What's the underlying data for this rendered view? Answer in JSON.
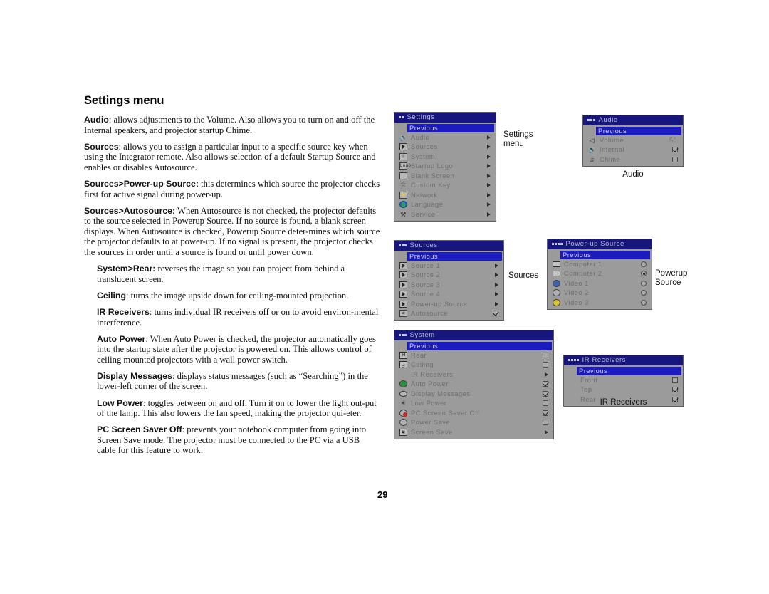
{
  "document": {
    "title": "Settings menu",
    "page_number": "29",
    "paragraphs": [
      {
        "id": "audio",
        "term": "Audio",
        "text": ": allows adjustments to the Volume. Also allows you to turn on and off the Internal speakers, and projector startup Chime.",
        "indent": false
      },
      {
        "id": "sources",
        "term": "Sources",
        "text": ": allows you to assign a particular input to a specific source key when using the Integrator remote. Also allows selection of a default Startup Source and enables or disables Autosource.",
        "indent": false
      },
      {
        "id": "sources-power-up-source",
        "term": "Sources>Power-up Source:",
        "text": " this determines which source the projector checks first for active signal during power-up.",
        "indent": false
      },
      {
        "id": "sources-autosource",
        "term": "Sources>Autosource:",
        "text": " When Autosource is not checked, the projector defaults to the source selected in Powerup Source. If no source is found, a blank screen displays. When Autosource is checked, Powerup Source deter-mines which source the projector defaults to at power-up. If no signal is present, the projector checks the sources in order until a source is found or until power down.",
        "indent": false
      },
      {
        "id": "system-rear",
        "term": "System>Rear:",
        "text": " reverses the image so you can project from behind a translucent screen.",
        "indent": true
      },
      {
        "id": "ceiling",
        "term": "Ceiling",
        "text": ": turns the image upside down for ceiling-mounted projection.",
        "indent": true
      },
      {
        "id": "ir-receivers",
        "term": "IR Receivers",
        "text": ": turns individual IR receivers off or on to avoid environ-mental interference.",
        "indent": true
      },
      {
        "id": "auto-power",
        "term": "Auto Power",
        "text": ": When Auto Power is checked, the projector automatically goes into the startup state after the projector is powered on. This allows control of ceiling mounted projectors with a wall power switch.",
        "indent": true
      },
      {
        "id": "display-messages",
        "term": "Display Messages",
        "text": ": displays status messages (such as “Searching”) in the lower-left corner of the screen.",
        "indent": true
      },
      {
        "id": "low-power",
        "term": "Low Power",
        "text": ": toggles between on and off. Turn it on to lower the light out-put of the lamp. This also lowers the fan speed, making the projector qui-eter.",
        "indent": true
      },
      {
        "id": "pc-screen-saver-off",
        "term": "PC Screen Saver Off",
        "text": ": prevents your notebook computer from going into Screen Save mode. The projector must be connected to the PC via a USB cable for this feature to work.",
        "indent": true
      }
    ]
  },
  "captions": {
    "settings_menu": "Settings\nmenu",
    "settings_menu_l1": "Settings",
    "settings_menu_l2": "menu",
    "audio": "Audio",
    "sources": "Sources",
    "powerup_source_l1": "Powerup",
    "powerup_source_l2": "Source",
    "ir_receivers": "IR Receivers"
  },
  "menus": {
    "settings": {
      "title": "Settings",
      "dots": 2,
      "previous": "Previous",
      "items": [
        {
          "label": "Audio",
          "icon": "speaker-icon",
          "control": "arrow"
        },
        {
          "label": "Sources",
          "icon": "source-input-icon",
          "control": "arrow"
        },
        {
          "label": "System",
          "icon": "system-icon",
          "control": "arrow"
        },
        {
          "label": "Startup Logo",
          "icon": "logo-icon",
          "control": "arrow"
        },
        {
          "label": "Blank Screen",
          "icon": "blank-screen-icon",
          "control": "arrow"
        },
        {
          "label": "Custom Key",
          "icon": "star-icon",
          "control": "arrow"
        },
        {
          "label": "Network",
          "icon": "network-icon",
          "control": "arrow"
        },
        {
          "label": "Language",
          "icon": "globe-icon",
          "control": "arrow"
        },
        {
          "label": "Service",
          "icon": "wrench-icon",
          "control": "arrow"
        }
      ]
    },
    "audio": {
      "title": "Audio",
      "dots": 3,
      "previous": "Previous",
      "items": [
        {
          "label": "Volume",
          "icon": "volume-icon",
          "control": "value",
          "value": "50"
        },
        {
          "label": "Internal",
          "icon": "speaker-icon",
          "control": "checkbox",
          "checked": true
        },
        {
          "label": "Chime",
          "icon": "chime-icon",
          "control": "checkbox",
          "checked": false
        }
      ]
    },
    "sources": {
      "title": "Sources",
      "dots": 3,
      "previous": "Previous",
      "items": [
        {
          "label": "Source 1",
          "icon": "source-input-icon",
          "control": "arrow"
        },
        {
          "label": "Source 2",
          "icon": "source-input-icon",
          "control": "arrow"
        },
        {
          "label": "Source 3",
          "icon": "source-input-icon",
          "control": "arrow"
        },
        {
          "label": "Source 4",
          "icon": "source-input-icon",
          "control": "arrow"
        },
        {
          "label": "Power-up Source",
          "icon": "powerup-source-icon",
          "control": "arrow"
        },
        {
          "label": "Autosource",
          "icon": "autosource-icon",
          "control": "checkbox",
          "checked": true
        }
      ]
    },
    "powerup_source": {
      "title": "Power-up Source",
      "dots": 4,
      "previous": "Previous",
      "items": [
        {
          "label": "Computer 1",
          "icon": "computer1-icon",
          "control": "radio",
          "checked": false
        },
        {
          "label": "Computer 2",
          "icon": "computer2-icon",
          "control": "radio",
          "checked": true
        },
        {
          "label": "Video 1",
          "icon": "video1-icon",
          "control": "radio",
          "checked": false
        },
        {
          "label": "Video 2",
          "icon": "video2-icon",
          "control": "radio",
          "checked": false
        },
        {
          "label": "Video 3",
          "icon": "video3-icon",
          "control": "radio",
          "checked": false
        }
      ]
    },
    "system": {
      "title": "System",
      "dots": 3,
      "previous": "Previous",
      "items": [
        {
          "label": "Rear",
          "icon": "rear-icon",
          "control": "checkbox",
          "checked": false
        },
        {
          "label": "Ceiling",
          "icon": "ceiling-icon",
          "control": "checkbox",
          "checked": false
        },
        {
          "label": "IR Receivers",
          "icon": "none",
          "control": "arrow"
        },
        {
          "label": "Auto Power",
          "icon": "auto-power-icon",
          "control": "checkbox",
          "checked": true
        },
        {
          "label": "Display Messages",
          "icon": "message-icon",
          "control": "checkbox",
          "checked": true
        },
        {
          "label": "Low Power",
          "icon": "low-power-icon",
          "control": "checkbox",
          "checked": false
        },
        {
          "label": "PC Screen Saver Off",
          "icon": "pc-screensaver-icon",
          "control": "checkbox",
          "checked": true
        },
        {
          "label": "Power Save",
          "icon": "power-save-icon",
          "control": "checkbox",
          "checked": false
        },
        {
          "label": "Screen Save",
          "icon": "screen-save-icon",
          "control": "arrow"
        }
      ]
    },
    "ir_receivers": {
      "title": "IR Receivers",
      "dots": 4,
      "previous": "Previous",
      "items": [
        {
          "label": "Front",
          "icon": "none",
          "control": "checkbox",
          "checked": false
        },
        {
          "label": "Top",
          "icon": "none",
          "control": "checkbox",
          "checked": true
        },
        {
          "label": "Rear",
          "icon": "none",
          "control": "checkbox",
          "checked": true
        }
      ]
    }
  },
  "colors": {
    "osd_title_bg": "#16167e",
    "osd_body_bg": "#9b9b9b",
    "osd_highlight_bg": "#1b1bbe",
    "osd_text": "#6e6e6e",
    "page_bg": "#ffffff"
  }
}
